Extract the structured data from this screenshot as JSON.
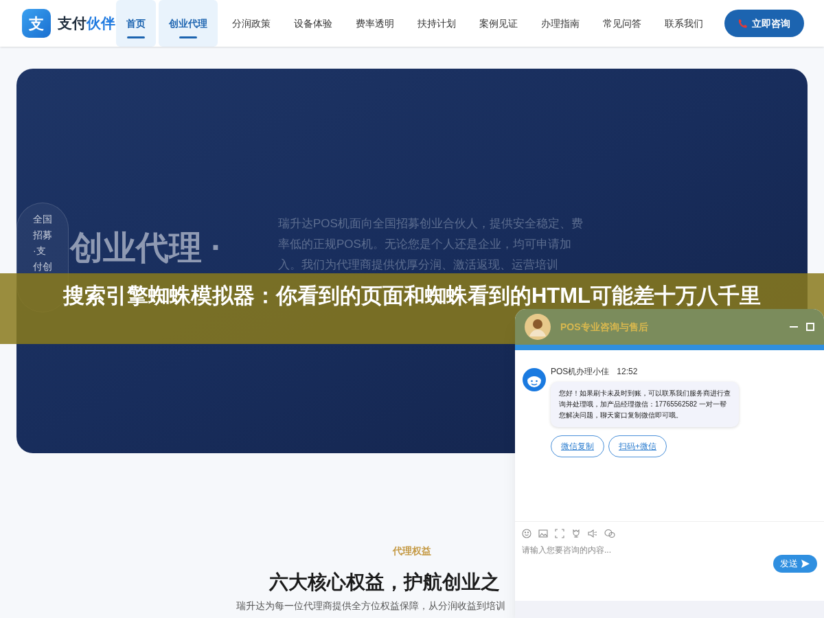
{
  "header": {
    "logo": {
      "mark": "支",
      "name": "支付",
      "accent": "伙伴"
    },
    "nav": [
      {
        "label": "首页",
        "selected": true
      },
      {
        "label": "创业代理",
        "selected": true
      },
      {
        "label": "分润政策",
        "selected": false
      },
      {
        "label": "设备体验",
        "selected": false
      },
      {
        "label": "费率透明",
        "selected": false
      },
      {
        "label": "扶持计划",
        "selected": false
      },
      {
        "label": "案例见证",
        "selected": false
      },
      {
        "label": "办理指南",
        "selected": false
      },
      {
        "label": "常见问答",
        "selected": false
      },
      {
        "label": "联系我们",
        "selected": false
      }
    ],
    "cta": "立即咨询"
  },
  "hero": {
    "badge": "全国招募·支付创",
    "title": "创业代理 ·",
    "description": "瑞升达POS机面向全国招募创业合伙人，提供安全稳定、费率低的正规POS机。无论您是个人还是企业，均可申请加入。我们为代理商提供优厚分润、激活返现、运营培训"
  },
  "benefits": {
    "eyebrow": "代理权益",
    "heading": "六大核心权益，护航创业之",
    "intro": "瑞升达为每一位代理商提供全方位权益保障，从分润收益到培训"
  },
  "banner": "搜索引擎蜘蛛模拟器：你看到的页面和蜘蛛看到的HTML可能差十万八千里",
  "chat": {
    "title": "POS专业咨询与售后",
    "message": {
      "sender": "POS机办理小佳",
      "time": "12:52",
      "text": "您好！如果刷卡未及时到账，可以联系我们服务商进行查询并处理哦，加产品经理微信：17765562582 一对一帮您解决问题，聊天窗口复制微信即可哦。"
    },
    "actions": [
      "微信复制",
      "扫码+微信"
    ],
    "input": {
      "placeholder": "请输入您要咨询的内容..."
    },
    "send": "发送"
  }
}
